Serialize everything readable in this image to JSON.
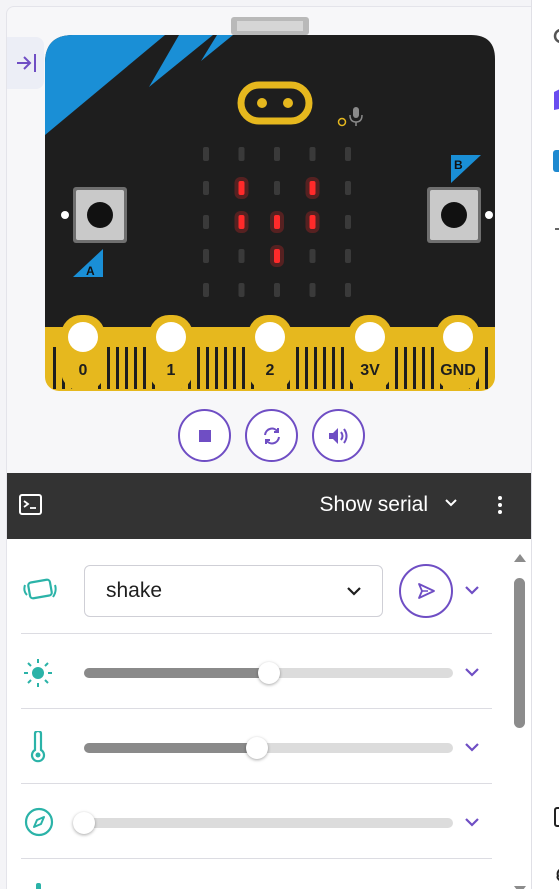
{
  "simulator": {
    "pin_labels": [
      "0",
      "1",
      "2",
      "3V",
      "GND"
    ],
    "button_a_label": "A",
    "button_b_label": "B",
    "led_matrix": [
      [
        0,
        0,
        0,
        0,
        0
      ],
      [
        0,
        1,
        0,
        1,
        0
      ],
      [
        0,
        1,
        1,
        1,
        0
      ],
      [
        0,
        0,
        1,
        0,
        0
      ],
      [
        0,
        0,
        0,
        0,
        0
      ]
    ],
    "board_color": "#1e1e1e",
    "accent_color": "#1a8fd6",
    "gold_color": "#e6b81e",
    "led_on_color": "#ff2a2a"
  },
  "controls": {
    "stop_icon": "stop-icon",
    "restart_icon": "restart-icon",
    "sound_icon": "volume-icon"
  },
  "serial": {
    "label": "Show serial",
    "terminal_icon": "terminal-icon",
    "more_icon": "more-vertical-icon"
  },
  "sensors": {
    "gesture": {
      "icon": "gesture-icon",
      "selected": "shake"
    },
    "light": {
      "icon": "light-icon",
      "level_fraction": 0.5
    },
    "temperature": {
      "icon": "thermometer-icon",
      "level_fraction": 0.47
    },
    "compass": {
      "icon": "compass-icon",
      "level_fraction": 0.0
    }
  },
  "theme": {
    "accent_purple": "#6f4ec4",
    "sensor_teal": "#2bb3a8"
  }
}
